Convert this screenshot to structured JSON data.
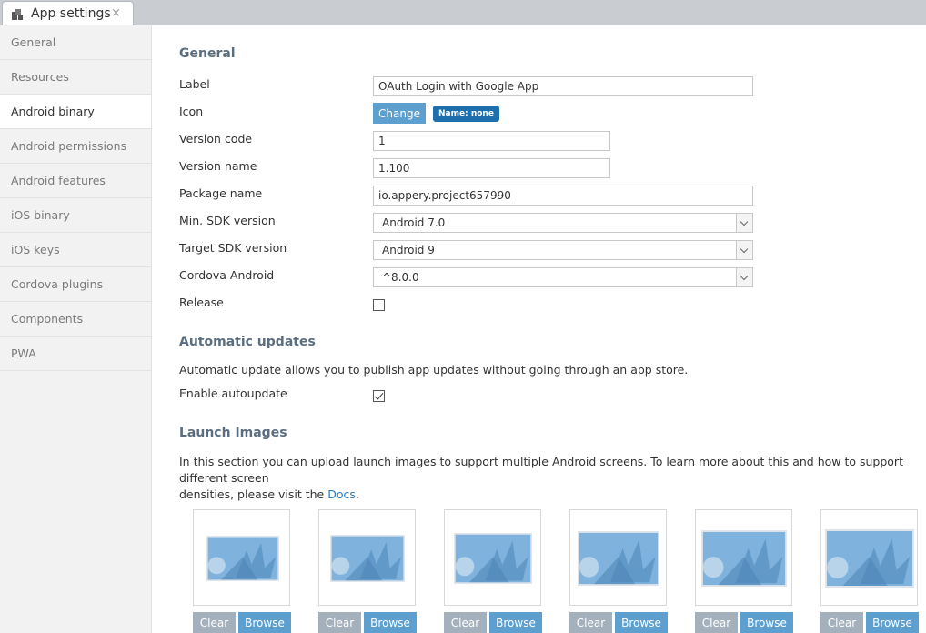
{
  "tab": {
    "title": "App settings",
    "close": "×"
  },
  "sidebar": {
    "items": [
      {
        "label": "General"
      },
      {
        "label": "Resources"
      },
      {
        "label": "Android binary"
      },
      {
        "label": "Android permissions"
      },
      {
        "label": "Android features"
      },
      {
        "label": "iOS binary"
      },
      {
        "label": "iOS keys"
      },
      {
        "label": "Cordova plugins"
      },
      {
        "label": "Components"
      },
      {
        "label": "PWA"
      }
    ],
    "active_item": "Android binary"
  },
  "general": {
    "title": "General",
    "label_label": "Label",
    "label_value": "OAuth Login with Google App",
    "icon_label": "Icon",
    "change_button": "Change",
    "icon_badge": "Name: none",
    "version_code_label": "Version code",
    "version_code_value": "1",
    "version_name_label": "Version name",
    "version_name_value": "1.100",
    "package_name_label": "Package name",
    "package_name_value": "io.appery.project657990",
    "min_sdk_label": "Min. SDK version",
    "min_sdk_value": "Android 7.0",
    "target_sdk_label": "Target SDK version",
    "target_sdk_value": "Android 9",
    "cordova_label": "Cordova Android",
    "cordova_value": "^8.0.0",
    "release_label": "Release",
    "release_checked": false
  },
  "auto_updates": {
    "title": "Automatic updates",
    "description": "Automatic update allows you to publish app updates without going through an app store.",
    "enable_label": "Enable autoupdate",
    "enabled": true
  },
  "launch_images": {
    "title": "Launch Images",
    "description_1": "In this section you can upload launch images to support multiple Android screens. To learn more about this and how to support different screen",
    "description_2": "densities, please visit the",
    "docs_link": "Docs",
    "period": ".",
    "clear_label": "Clear",
    "browse_label": "Browse"
  },
  "colors": {
    "accent": "#5d9fcf",
    "badge": "#1d6fae",
    "section_title": "#5b6e80",
    "clear_button": "#a4b0bb",
    "sidebar_bg": "#f2f2f2"
  }
}
